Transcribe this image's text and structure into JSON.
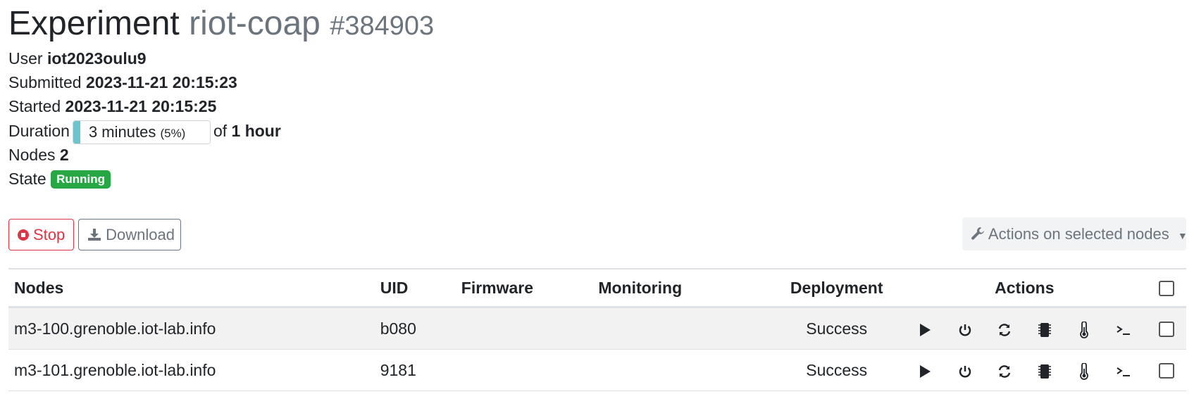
{
  "header": {
    "title_prefix": "Experiment",
    "name": "riot-coap",
    "number": "#384903"
  },
  "info": {
    "user_label": "User",
    "user_value": "iot2023oulu9",
    "submitted_label": "Submitted",
    "submitted_value": "2023-11-21 20:15:23",
    "started_label": "Started",
    "started_value": "2023-11-21 20:15:25",
    "duration_label": "Duration",
    "duration_value": "3 minutes",
    "duration_percent_text": "(5%)",
    "duration_progress": 0.05,
    "duration_of": "of",
    "duration_total": "1 hour",
    "nodes_label": "Nodes",
    "nodes_value": "2",
    "state_label": "State",
    "state_value": "Running"
  },
  "toolbar": {
    "stop_label": "Stop",
    "download_label": "Download",
    "actions_label": "Actions on selected nodes"
  },
  "table": {
    "headers": {
      "nodes": "Nodes",
      "uid": "UID",
      "firmware": "Firmware",
      "monitoring": "Monitoring",
      "deployment": "Deployment",
      "actions": "Actions"
    },
    "rows": [
      {
        "node": "m3-100.grenoble.iot-lab.info",
        "uid": "b080",
        "firmware": "",
        "monitoring": "",
        "deployment": "Success"
      },
      {
        "node": "m3-101.grenoble.iot-lab.info",
        "uid": "9181",
        "firmware": "",
        "monitoring": "",
        "deployment": "Success"
      }
    ]
  },
  "colors": {
    "success": "#28a745",
    "danger": "#dc3545",
    "muted": "#6c757d",
    "progress": "#6ec3cf"
  }
}
